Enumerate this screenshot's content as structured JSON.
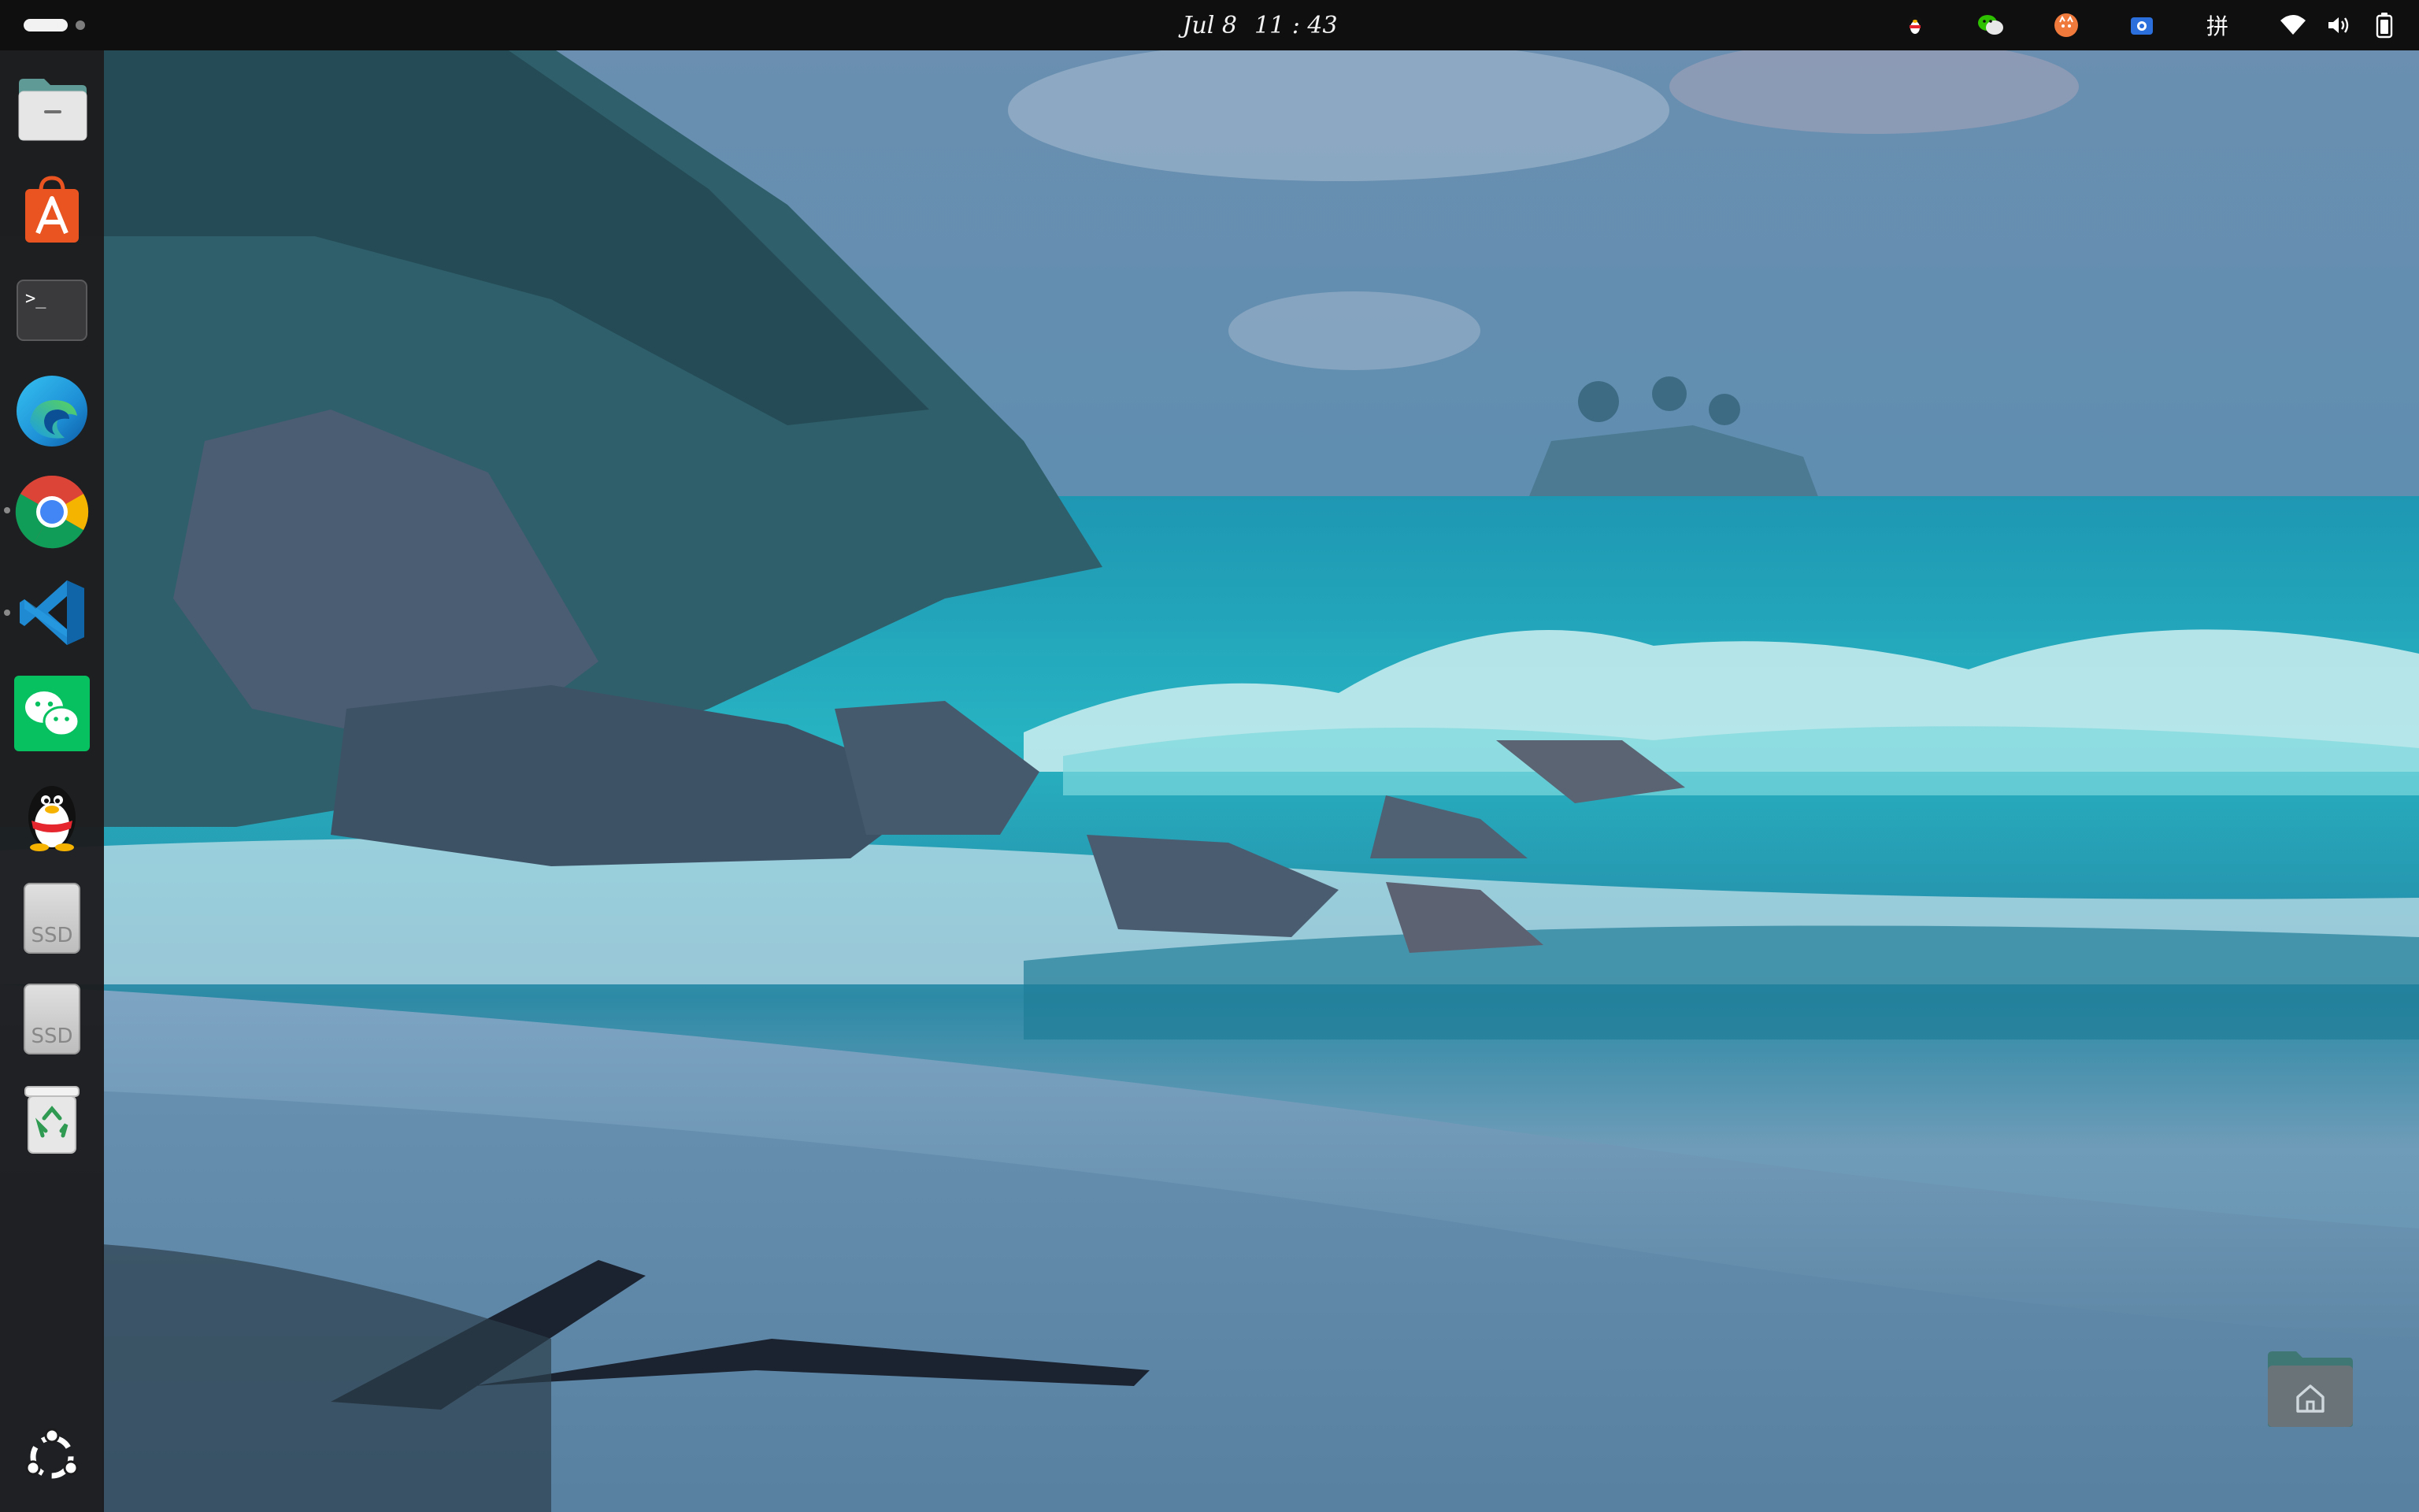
{
  "top_bar": {
    "clock": {
      "date": "Jul 8",
      "time": "11 : 43"
    },
    "tray": {
      "ime_label": "拼",
      "icons": [
        "qq-tray-icon",
        "wechat-tray-icon",
        "cat-tray-icon",
        "camera-tray-icon",
        "ime-indicator",
        "wifi-icon",
        "volume-icon",
        "battery-icon"
      ]
    }
  },
  "dock": {
    "apps": [
      {
        "name": "files",
        "icon": "folder-icon"
      },
      {
        "name": "app-center",
        "icon": "store-icon"
      },
      {
        "name": "terminal",
        "icon": "terminal-icon",
        "prompt": ">_"
      },
      {
        "name": "edge",
        "icon": "edge-icon"
      },
      {
        "name": "chrome",
        "icon": "chrome-icon",
        "running": true
      },
      {
        "name": "vscode",
        "icon": "vscode-icon",
        "running": true
      },
      {
        "name": "wechat",
        "icon": "wechat-icon"
      },
      {
        "name": "qq",
        "icon": "qq-penguin-icon"
      },
      {
        "name": "ssd-1",
        "icon": "drive-icon",
        "label": "SSD"
      },
      {
        "name": "ssd-2",
        "icon": "drive-icon",
        "label": "SSD"
      },
      {
        "name": "trash",
        "icon": "trash-icon"
      }
    ],
    "show_apps_icon": "ubuntu-logo-icon"
  },
  "desktop": {
    "items": [
      {
        "name": "home",
        "icon": "home-folder-icon"
      }
    ]
  },
  "colors": {
    "top_bar_bg": "#0f0f10",
    "dock_bg": "#1c1c1e",
    "ubuntu_orange": "#e95420",
    "wechat_green": "#07c160",
    "vscode_blue": "#1f8ad2"
  }
}
